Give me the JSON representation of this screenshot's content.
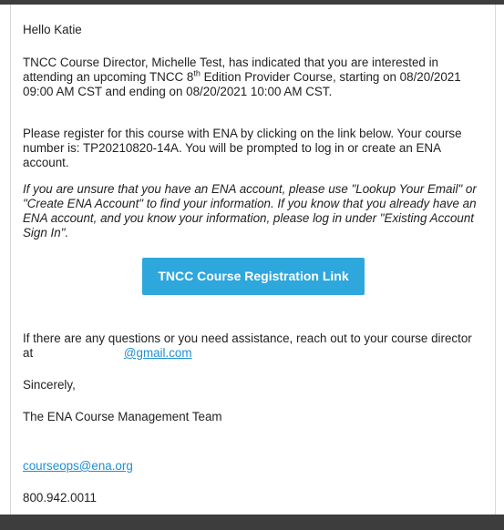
{
  "email": {
    "greeting": "Hello Katie",
    "intro": {
      "part1": "TNCC Course Director, Michelle Test, has indicated that you are interested in attending an upcoming TNCC 8",
      "superscript": "th",
      "part2": " Edition Provider Course, starting on 08/20/2021 09:00 AM CST and ending on 08/20/2021 10:00 AM CST."
    },
    "register_text": "Please register for this course with ENA by clicking on the link below. Your course number is: TP20210820-14A. You will be prompted to log in or create an ENA account.",
    "note_text": "If you are unsure that you have an ENA account, please use \"Lookup Your Email\" or \"Create ENA Account\" to find your information. If you know that you already have an ENA account, and you know your information, please log in under \"Existing Account Sign In\".",
    "cta_label": "TNCC Course Registration Link",
    "questions_text": "If there are any questions or you need assistance, reach out to your course director at",
    "director_email": "@gmail.com",
    "sincerely": "Sincerely,",
    "team": "The ENA Course Management Team",
    "ops_email": "courseops@ena.org",
    "phone": "800.942.0011"
  },
  "colors": {
    "cta_background": "#2ea7dd",
    "link": "#1f8fd1",
    "frame_bar": "#3d3d3d"
  }
}
